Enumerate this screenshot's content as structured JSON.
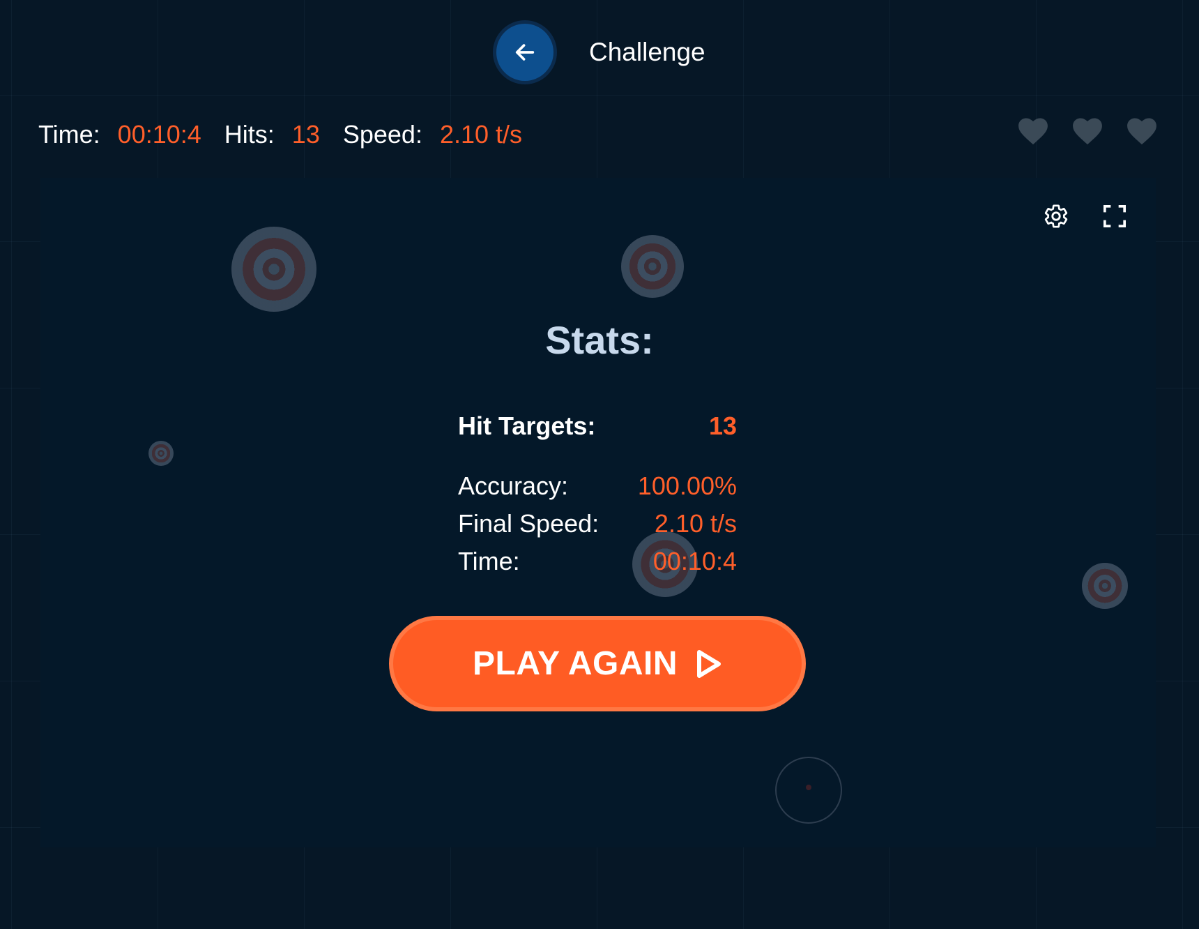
{
  "header": {
    "title": "Challenge",
    "back_icon": "arrow-left-icon"
  },
  "stats_bar": {
    "time_label": "Time:",
    "time_value": "00:10:4",
    "hits_label": "Hits:",
    "hits_value": "13",
    "speed_label": "Speed:",
    "speed_value": "2.10 t/s"
  },
  "lives": {
    "icon": "heart-icon",
    "count": 3,
    "color": "#3b4a57"
  },
  "toolbar": {
    "settings_icon": "gear-icon",
    "fullscreen_icon": "fullscreen-icon"
  },
  "summary": {
    "title": "Stats:",
    "hit_targets_label": "Hit Targets:",
    "hit_targets_value": "13",
    "accuracy_label": "Accuracy:",
    "accuracy_value": "100.00%",
    "final_speed_label": "Final Speed:",
    "final_speed_value": "2.10 t/s",
    "time_label": "Time:",
    "time_value": "00:10:4"
  },
  "play_again": {
    "label": "PLAY AGAIN",
    "icon": "play-icon"
  },
  "colors": {
    "background": "#061726",
    "accent": "#ff5c24",
    "value_text": "#ff5f2a",
    "back_button": "#0d4f8e",
    "stats_title": "#c8d9ec"
  }
}
